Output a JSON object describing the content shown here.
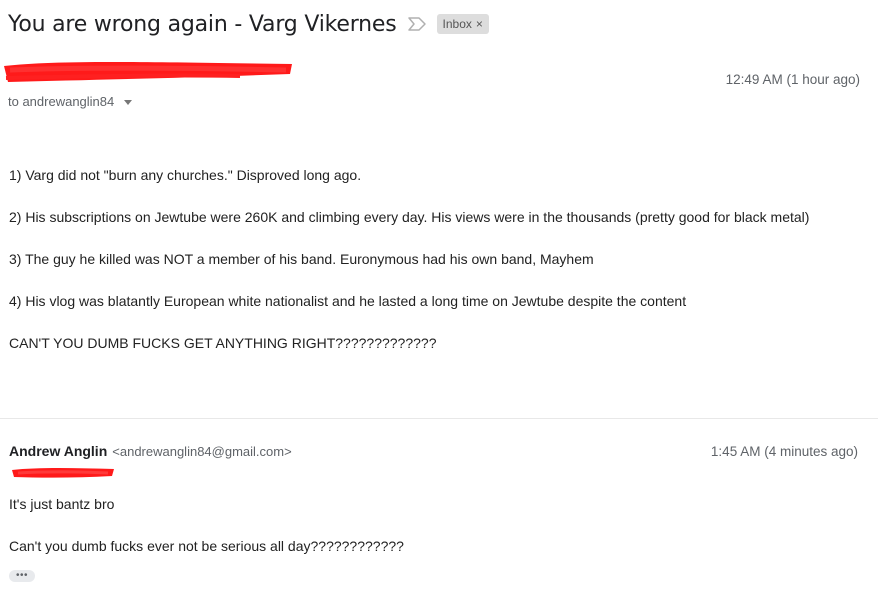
{
  "thread": {
    "subject": "You are wrong again - Varg Vikernes",
    "label": "Inbox",
    "label_remove": "×"
  },
  "message1": {
    "to_line": "to andrewanglin84",
    "timestamp": "12:49 AM (1 hour ago)",
    "body": [
      "1) Varg did not \"burn any churches.\" Disproved long ago.",
      "2) His subscriptions on Jewtube were 260K and climbing every day. His views were in the thousands (pretty good for black metal)",
      "3) The guy he killed was NOT a member of his band. Euronymous had his own band, Mayhem",
      "4) His vlog was blatantly European white nationalist and he lasted a long time on Jewtube despite the content",
      "CAN'T YOU DUMB FUCKS GET ANYTHING RIGHT?????????????"
    ]
  },
  "message2": {
    "sender_name": "Andrew Anglin",
    "sender_email": "<andrewanglin84@gmail.com>",
    "timestamp": "1:45 AM (4 minutes ago)",
    "body": [
      "It's just bantz bro",
      "Can't you dumb fucks ever not be serious all day????????????"
    ],
    "ellipsis": "•••"
  },
  "colors": {
    "redaction": "#ff0000",
    "text": "#222222",
    "muted": "#5f6368",
    "chip": "#dddddd"
  }
}
